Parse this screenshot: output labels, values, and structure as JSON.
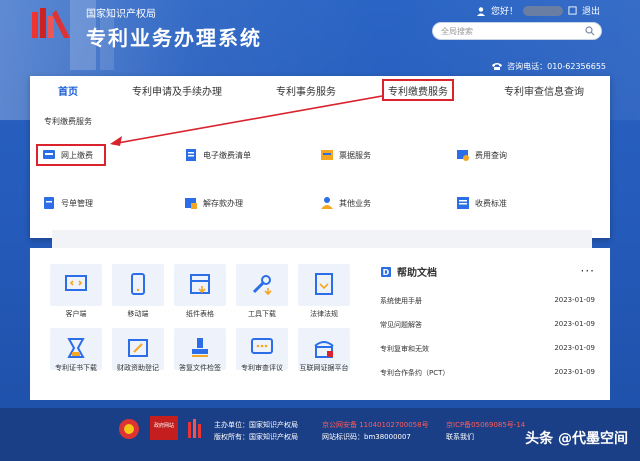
{
  "header": {
    "org": "国家知识产权局",
    "system_title": "专利业务办理系统",
    "greeting": "您好！",
    "logout": "退出",
    "search_placeholder": "全局搜索",
    "hotline": "咨询电话：010-62356655"
  },
  "nav": {
    "tabs": [
      "首页",
      "专利申请及手续办理",
      "专利事务服务",
      "专利缴费服务",
      "专利审查信息查询"
    ]
  },
  "fee_service": {
    "title": "专利缴费服务",
    "items": [
      "网上缴费",
      "电子缴费清单",
      "票据服务",
      "费用查询",
      "号单管理",
      "解存款办理",
      "其他业务",
      "收费标准"
    ]
  },
  "tools": {
    "items": [
      "客户端",
      "移动端",
      "纸件表格",
      "工具下载",
      "法律法规",
      "专利证书下载",
      "财政资助登记",
      "答复文件检签",
      "专利审查评议",
      "互联网证据平台"
    ]
  },
  "help": {
    "title": "帮助文档",
    "more": "···",
    "rows": [
      {
        "name": "系统使用手册",
        "date": "2023-01-09"
      },
      {
        "name": "常见问题解答",
        "date": "2023-01-09"
      },
      {
        "name": "专利复审和无效",
        "date": "2023-01-09"
      },
      {
        "name": "专利合作条约（PCT）",
        "date": "2023-01-09"
      }
    ]
  },
  "footer": {
    "org_line": "主办单位：国家知识产权局",
    "copyright_line": "版权所有：国家知识产权局",
    "police": "京公网安备 11040102700058号",
    "site_id": "网站标识码：bm38000007",
    "icp": "京ICP备05069085号-14",
    "contact": "联系我们",
    "badge": "政府网站",
    "watermark": "头条 @代墨空间"
  },
  "colors": {
    "brand": "#1b5fd9",
    "highlight": "#d9232d",
    "footer": "#1b3f86"
  }
}
